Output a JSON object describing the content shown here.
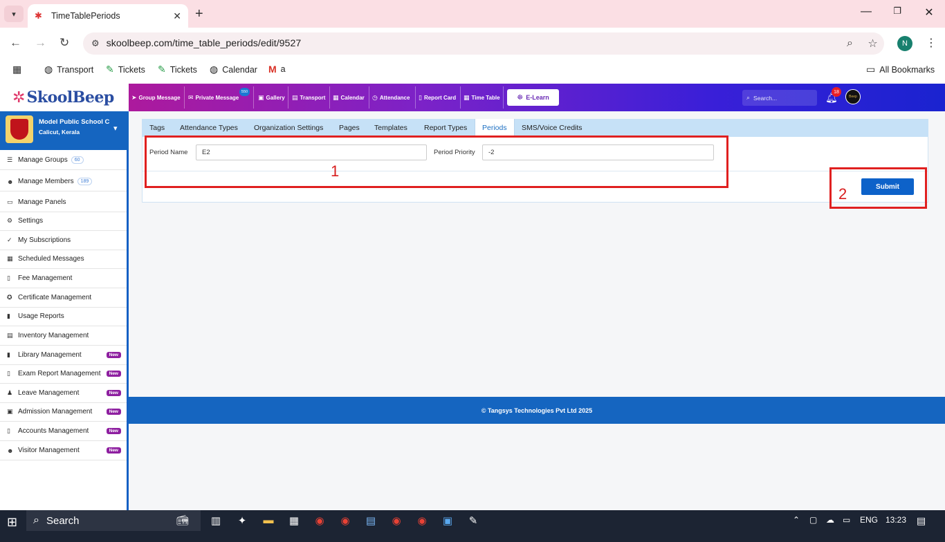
{
  "browser": {
    "tab_title": "TimeTablePeriods",
    "url": "skoolbeep.com/time_table_periods/edit/9527",
    "profile_initial": "N",
    "bookmarks": [
      {
        "label": "Transport"
      },
      {
        "label": "Tickets"
      },
      {
        "label": "Tickets"
      },
      {
        "label": "Calendar"
      },
      {
        "label": "a"
      }
    ],
    "all_bookmarks": "All Bookmarks"
  },
  "header": {
    "brand": "SkoolBeep",
    "nav": [
      {
        "label": "Group Message"
      },
      {
        "label": "Private Message"
      },
      {
        "label": "Gallery"
      },
      {
        "label": "Transport"
      },
      {
        "label": "Calendar"
      },
      {
        "label": "Attendance"
      },
      {
        "label": "Report Card"
      },
      {
        "label": "Time Table"
      }
    ],
    "private_message_badge": "550",
    "elearn_label": "E-Learn",
    "search_placeholder": "Search...",
    "notification_count": "18",
    "avatar_text": "Beep"
  },
  "school": {
    "name": "Model Public School C",
    "location": "Calicut, Kerala"
  },
  "sidebar": {
    "items": [
      {
        "label": "Manage Groups",
        "count": "60"
      },
      {
        "label": "Manage Members",
        "count": "189"
      },
      {
        "label": "Manage Panels"
      },
      {
        "label": "Settings"
      },
      {
        "label": "My Subscriptions"
      },
      {
        "label": "Scheduled Messages"
      },
      {
        "label": "Fee Management"
      },
      {
        "label": "Certificate Management"
      },
      {
        "label": "Usage Reports"
      },
      {
        "label": "Inventory Management"
      },
      {
        "label": "Library Management",
        "badge": "New"
      },
      {
        "label": "Exam Report Management",
        "badge": "New"
      },
      {
        "label": "Leave Management",
        "badge": "New"
      },
      {
        "label": "Admission Management",
        "badge": "New"
      },
      {
        "label": "Accounts Management",
        "badge": "New"
      },
      {
        "label": "Visitor Management",
        "badge": "New"
      }
    ]
  },
  "settings_tabs": [
    {
      "label": "Tags"
    },
    {
      "label": "Attendance Types"
    },
    {
      "label": "Organization Settings"
    },
    {
      "label": "Pages"
    },
    {
      "label": "Templates"
    },
    {
      "label": "Report Types"
    },
    {
      "label": "Periods",
      "active": true
    },
    {
      "label": "SMS/Voice Credits"
    }
  ],
  "form": {
    "period_name_label": "Period Name",
    "period_name_value": "E2",
    "period_priority_label": "Period Priority",
    "period_priority_value": "-2",
    "submit_label": "Submit"
  },
  "annotations": {
    "box1_label": "1",
    "box2_label": "2",
    "color": "#e02020"
  },
  "footer": {
    "text": "© Tangsys Technologies Pvt Ltd 2025"
  },
  "taskbar": {
    "search_label": "Search",
    "language": "ENG",
    "time": "13:23"
  }
}
